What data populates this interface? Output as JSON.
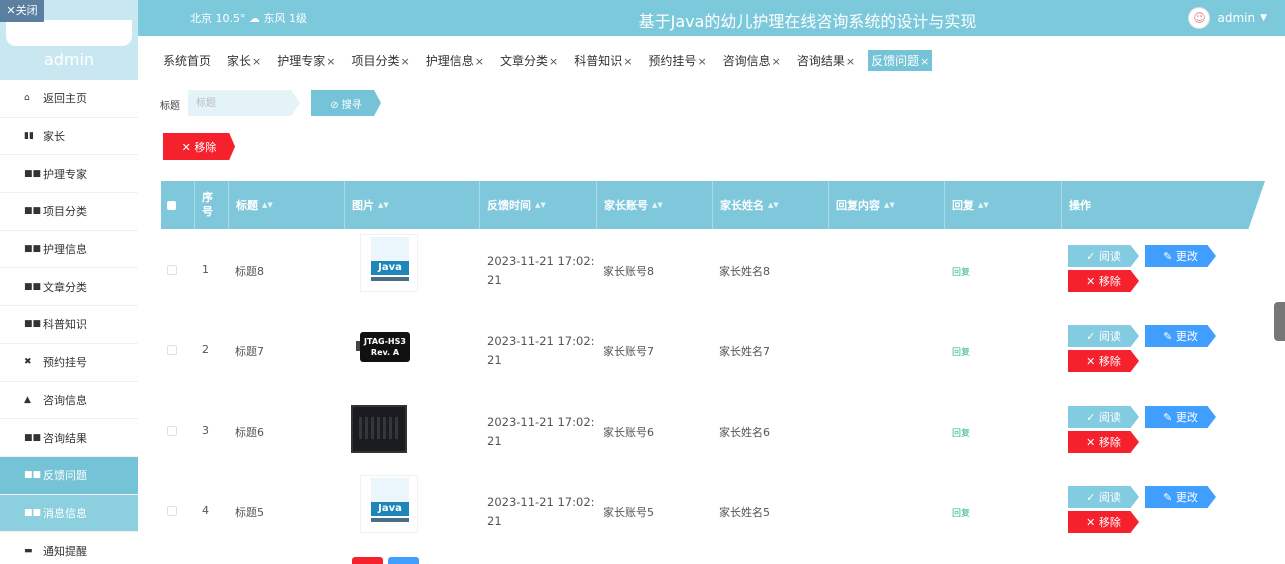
{
  "header": {
    "weather": "北京  10.5°  ☁ 东风  1级",
    "title": "基于Java的幼儿护理在线咨询系统的设计与实现",
    "user": "admin"
  },
  "sidebar": {
    "close": "✕关闭",
    "name": "admin",
    "items": [
      {
        "label": "返回主页",
        "icon": "⌂"
      },
      {
        "label": "家长",
        "icon": "▮▮"
      },
      {
        "label": "护理专家",
        "icon": "■■"
      },
      {
        "label": "项目分类",
        "icon": "■■"
      },
      {
        "label": "护理信息",
        "icon": "■■"
      },
      {
        "label": "文章分类",
        "icon": "■■"
      },
      {
        "label": "科普知识",
        "icon": "■■"
      },
      {
        "label": "预约挂号",
        "icon": "✖"
      },
      {
        "label": "咨询信息",
        "icon": "▲"
      },
      {
        "label": "咨询结果",
        "icon": "■■"
      },
      {
        "label": "反馈问题",
        "icon": "■■"
      },
      {
        "label": "消息信息",
        "icon": "■■"
      },
      {
        "label": "通知提醒",
        "icon": "▬"
      }
    ]
  },
  "tabs": [
    "系统首页",
    "家长",
    "护理专家",
    "项目分类",
    "护理信息",
    "文章分类",
    "科普知识",
    "预约挂号",
    "咨询信息",
    "咨询结果",
    "反馈问题"
  ],
  "tab_close": "×",
  "search": {
    "label": "标题",
    "placeholder": "标题",
    "button": "⊘ 搜寻"
  },
  "remove_all": "✕ 移除",
  "table": {
    "headers": [
      "序号",
      "标题",
      "图片",
      "反馈时间",
      "家长账号",
      "家长姓名",
      "回复内容",
      "回复",
      "操作"
    ],
    "rows": [
      {
        "index": "1",
        "title": "标题8",
        "time": "2023-11-21 17:02:21",
        "account": "家长账号8",
        "name": "家长姓名8",
        "reply": "回复",
        "pic": "java-book"
      },
      {
        "index": "2",
        "title": "标题7",
        "time": "2023-11-21 17:02:21",
        "account": "家长账号7",
        "name": "家长姓名7",
        "reply": "回复",
        "pic": "jtag-board"
      },
      {
        "index": "3",
        "title": "标题6",
        "time": "2023-11-21 17:02:21",
        "account": "家长账号6",
        "name": "家长姓名6",
        "reply": "回复",
        "pic": "dark-box"
      },
      {
        "index": "4",
        "title": "标题5",
        "time": "2023-11-21 17:02:21",
        "account": "家长账号5",
        "name": "家长姓名5",
        "reply": "回复",
        "pic": "java-book"
      }
    ],
    "read_label": "✓ 阅读",
    "edit_label": "✎ 更改",
    "delete_label": "✕ 移除"
  },
  "pics": {
    "java_text": "Java",
    "jtag_text_1": "JTAG-HS3",
    "jtag_text_2": "Rev. A"
  },
  "colors": {
    "accent": "#74c3d7",
    "danger": "#f5222d",
    "edit": "#409eff"
  }
}
